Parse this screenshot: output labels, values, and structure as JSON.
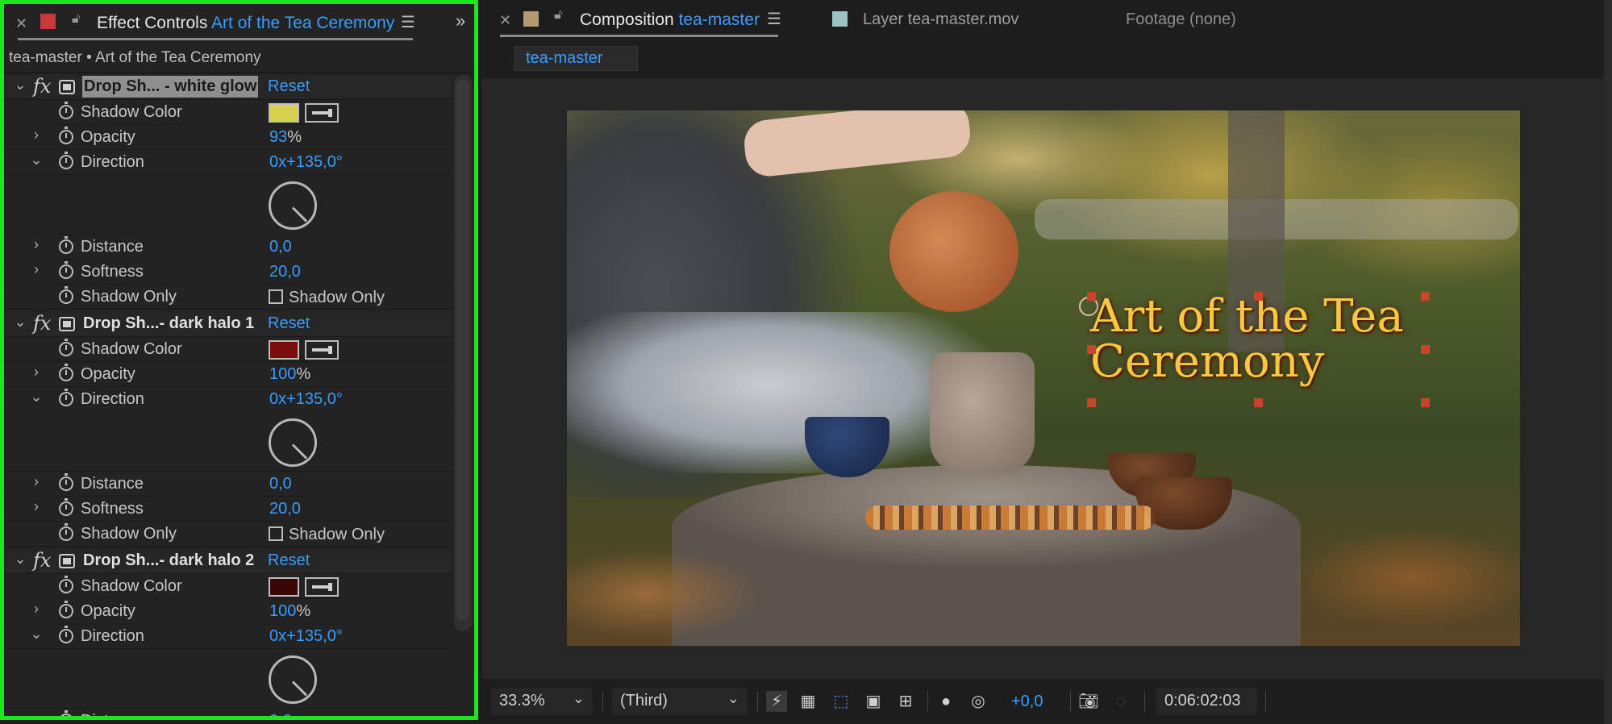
{
  "effect_controls": {
    "tab_prefix": "Effect Controls",
    "tab_layer": "Art of the Tea  Ceremony",
    "breadcrumb": "tea-master • Art of the Tea  Ceremony",
    "reset_label": "Reset",
    "effects": [
      {
        "name": "Drop Sh... - white glow",
        "props": {
          "shadow_color_label": "Shadow Color",
          "shadow_color": "#d6d14a",
          "opacity_label": "Opacity",
          "opacity_value": "93",
          "opacity_unit": "%",
          "direction_label": "Direction",
          "direction_value": "0x+135,0°",
          "distance_label": "Distance",
          "distance_value": "0,0",
          "softness_label": "Softness",
          "softness_value": "20,0",
          "shadow_only_label": "Shadow Only",
          "shadow_only_checkbox": "Shadow Only"
        }
      },
      {
        "name": "Drop Sh...- dark halo 1",
        "props": {
          "shadow_color_label": "Shadow Color",
          "shadow_color": "#7a0e0e",
          "opacity_label": "Opacity",
          "opacity_value": "100",
          "opacity_unit": "%",
          "direction_label": "Direction",
          "direction_value": "0x+135,0°",
          "distance_label": "Distance",
          "distance_value": "0,0",
          "softness_label": "Softness",
          "softness_value": "20,0",
          "shadow_only_label": "Shadow Only",
          "shadow_only_checkbox": "Shadow Only"
        }
      },
      {
        "name": "Drop Sh...- dark halo 2",
        "props": {
          "shadow_color_label": "Shadow Color",
          "shadow_color": "#3a0606",
          "opacity_label": "Opacity",
          "opacity_value": "100",
          "opacity_unit": "%",
          "direction_label": "Direction",
          "direction_value": "0x+135,0°",
          "distance_label": "Distance",
          "distance_value": "0,0"
        }
      }
    ]
  },
  "composition": {
    "tab_prefix": "Composition",
    "tab_name": "tea-master",
    "layer_tab": "Layer tea-master.mov",
    "footage_tab": "Footage (none)",
    "comp_tab": "tea-master",
    "title_line1": "Art of the Tea",
    "title_line2": "Ceremony",
    "title_color": "#f6c842"
  },
  "toolbar": {
    "zoom": "33.3%",
    "resolution": "(Third)",
    "exposure": "+0,0",
    "timecode": "0:06:02:03"
  },
  "colors": {
    "accent": "#3b9cff",
    "highlight_border": "#1ee61e"
  }
}
